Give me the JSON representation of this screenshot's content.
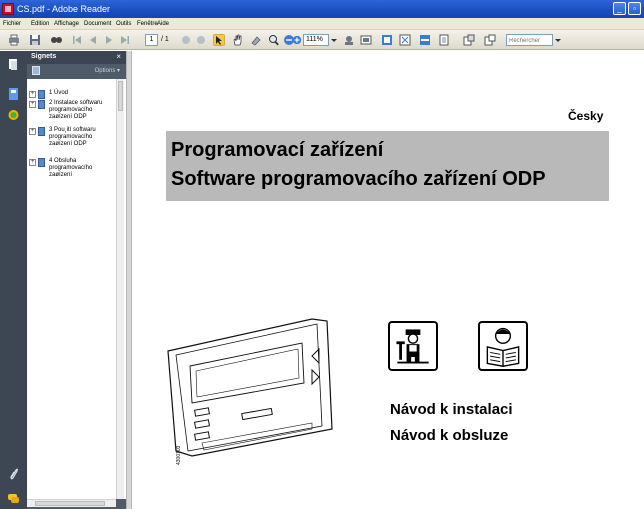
{
  "window": {
    "title": "CS.pdf - Adobe Reader",
    "minimize_glyph": "_",
    "maximize_glyph": "▫"
  },
  "menu": [
    "Fichier",
    "Edition",
    "Affichage",
    "Document",
    "Outils",
    "Fenêtre",
    "Aide"
  ],
  "toolbar": {
    "page_current": "1",
    "page_total": "/ 1",
    "zoom": "111%",
    "search_placeholder": "Rechercher"
  },
  "bookmarks_panel": {
    "title": "Signets",
    "close_glyph": "×",
    "options_label": "Options ▾",
    "items": [
      {
        "expander": "+",
        "label": "1 Úvod"
      },
      {
        "expander": "+",
        "label": "2 Instalace softwaru programovacího zaøízení ODP"
      },
      {
        "expander": "+",
        "label": "3 Pou¸ití softwaru programovacího zaøízení ODP"
      },
      {
        "expander": "+",
        "label": "4 Obsluha programovacího zaøízení"
      }
    ]
  },
  "document": {
    "language": "Česky",
    "title_line1": "Programovací zařízení",
    "title_line2": "Software programovacího zařízení ODP",
    "manual_line1": "Návod k instalaci",
    "manual_line2": "Návod k obsluze",
    "device_code": "4300103"
  },
  "colors": {
    "titlebar": "#1a4fc2",
    "panel_dark": "#3c4753",
    "panel": "#4f5b68",
    "title_band": "#b9b9b9",
    "acrobat_red": "#c8102e"
  },
  "icons": {
    "nav": [
      "pages-icon",
      "bookmarks-icon",
      "security-icon",
      "attachments-icon",
      "comments-icon"
    ],
    "manuals": [
      "installer-icon",
      "reader-icon"
    ]
  }
}
